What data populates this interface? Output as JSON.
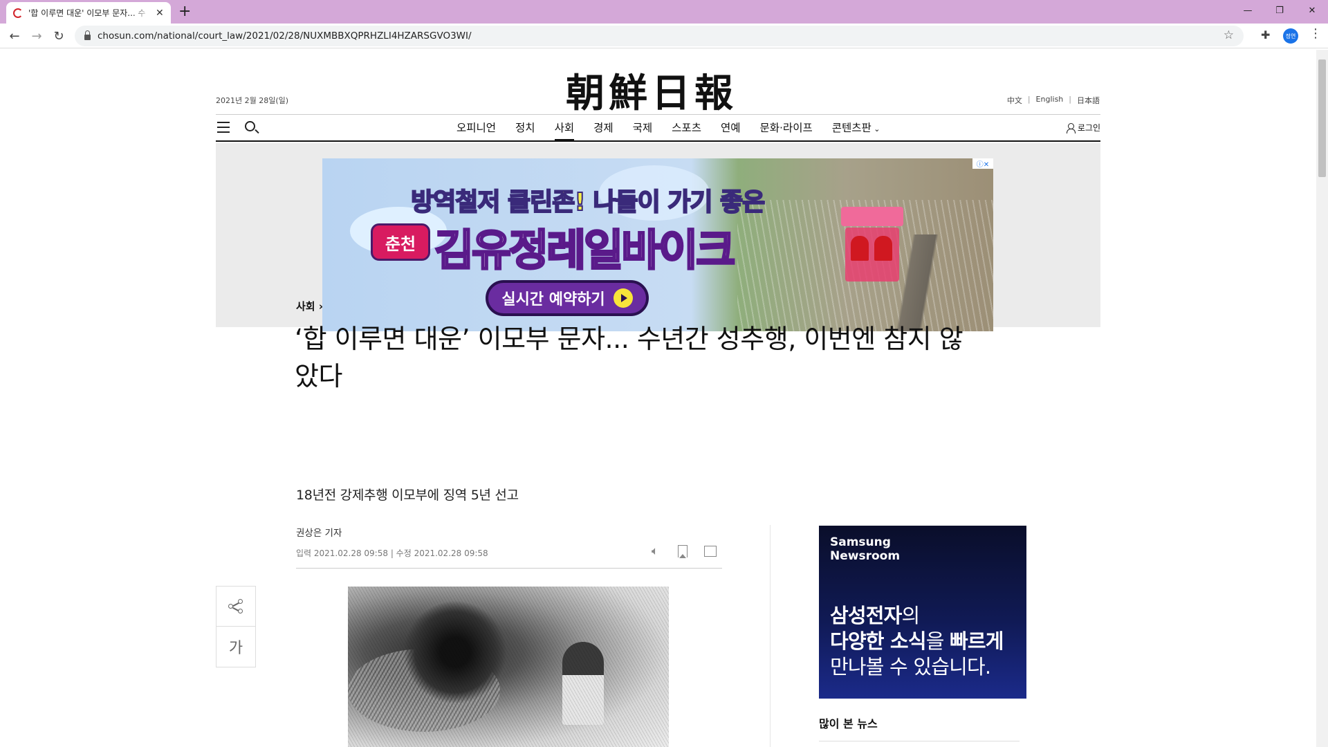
{
  "browser": {
    "tab_title": "'합 이루면 대운' 이모부 문자... 수",
    "tab_close": "✕",
    "new_tab": "+",
    "url": "chosun.com/national/court_law/2021/02/28/NUXMBBXQPRHZLI4HZARSGVO3WI/",
    "profile_initials": "정연",
    "win_min": "—",
    "win_restore": "❐",
    "win_close": "✕"
  },
  "site": {
    "logo": "朝鮮日報",
    "date": "2021년 2월 28일(일)",
    "languages": [
      "中文",
      "English",
      "日本語"
    ],
    "menu": [
      "오피니언",
      "정치",
      "사회",
      "경제",
      "국제",
      "스포츠",
      "연예",
      "문화·라이프",
      "콘텐츠판"
    ],
    "active_menu": "사회",
    "login": "로그인"
  },
  "banner": {
    "line1_a": "방역철저 ",
    "line1_b": "클린존!",
    "line1_c": " 나들이 가기 좋은",
    "tag": "춘천",
    "line2": "김유정레일바이크",
    "cta": "실시간 예약하기",
    "ad_info": "ⓘ✕"
  },
  "article": {
    "section": "사회",
    "headline": "‘합 이루면 대운’ 이모부 문자... 수년간 성추행, 이번엔 참지 않았다",
    "subheadline": "18년전 강제추행 이모부에 징역 5년 선고",
    "reporter": "권상은 기자",
    "timestamps": "입력 2021.02.28 09:58 | 수정 2021.02.28 09:58",
    "font_size_button": "가"
  },
  "sidebar": {
    "ad_brand": "Samsung Newsroom",
    "ad_line1_bold": "삼성전자",
    "ad_line1_rest": "의",
    "ad_line2_bold1": "다양한 소식",
    "ad_line2_mid": "을 ",
    "ad_line2_bold2": "빠르게",
    "ad_line3": "만나볼 수 있습니다.",
    "popular_title": "많이 본 뉴스"
  }
}
